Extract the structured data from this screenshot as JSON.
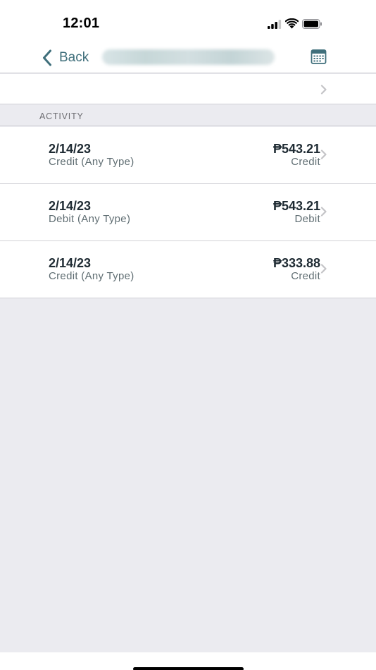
{
  "status_bar": {
    "time": "12:01"
  },
  "nav": {
    "back_label": "Back",
    "title": "",
    "icons": {
      "back": "chevron-left-icon",
      "calendar": "calendar-icon"
    }
  },
  "section": {
    "title": "ACTIVITY"
  },
  "activity": [
    {
      "date": "2/14/23",
      "description": "Credit (Any Type)",
      "amount": "₱543.21",
      "type": "Credit"
    },
    {
      "date": "2/14/23",
      "description": "Debit (Any Type)",
      "amount": "₱543.21",
      "type": "Debit"
    },
    {
      "date": "2/14/23",
      "description": "Credit (Any Type)",
      "amount": "₱333.88",
      "type": "Credit"
    }
  ],
  "colors": {
    "accent": "#3f6f7b",
    "background": "#ebebf0",
    "text_primary": "#1f2b33",
    "text_secondary": "#5f6d72",
    "chevron": "#c4c4c7"
  }
}
